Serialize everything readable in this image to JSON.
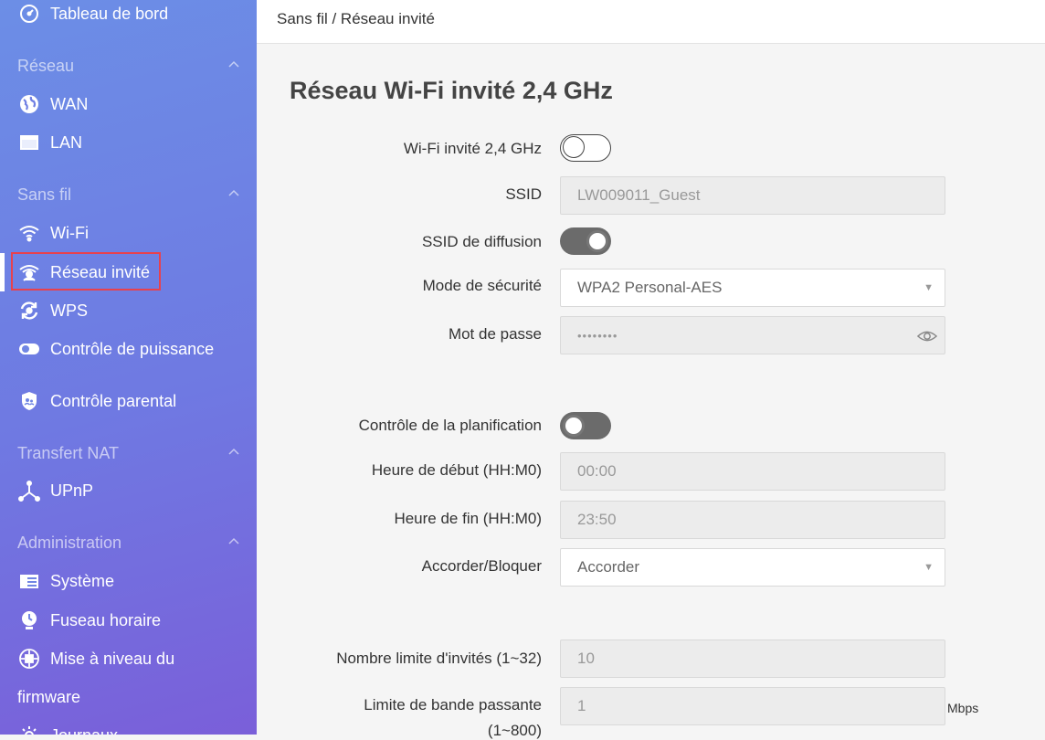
{
  "sidebar": {
    "dashboard": "Tableau de bord",
    "sections": [
      {
        "label": "Réseau",
        "items": [
          "WAN",
          "LAN"
        ]
      },
      {
        "label": "Sans fil",
        "items": [
          "Wi-Fi",
          "Réseau invité",
          "WPS",
          "Contrôle de puissance"
        ]
      },
      {
        "label": "Transfert NAT",
        "items": [
          "UPnP"
        ]
      },
      {
        "label": "Administration",
        "items": [
          "Système",
          "Fuseau horaire",
          "Mise à niveau du",
          "firmware",
          "Journaux"
        ]
      }
    ],
    "parental": "Contrôle parental",
    "active_item": "Réseau invité"
  },
  "header": {
    "breadcrumb": "Sans fil / Réseau invité"
  },
  "main": {
    "title": "Réseau Wi-Fi invité 2,4 GHz",
    "fields": {
      "wifi_guest": {
        "label": "Wi-Fi invité 2,4 GHz",
        "state": "off"
      },
      "ssid": {
        "label": "SSID",
        "value": "LW009011_Guest"
      },
      "broadcast": {
        "label": "SSID de diffusion",
        "state": "on"
      },
      "security": {
        "label": "Mode de sécurité",
        "value": "WPA2 Personal-AES"
      },
      "password": {
        "label": "Mot de passe",
        "value": "••••••••"
      },
      "schedule": {
        "label": "Contrôle de la planification",
        "state": "off"
      },
      "start": {
        "label": "Heure de début (HH:M0)",
        "value": "00:00"
      },
      "end": {
        "label": "Heure de fin (HH:M0)",
        "value": "23:50"
      },
      "allow": {
        "label": "Accorder/Bloquer",
        "value": "Accorder"
      },
      "limit": {
        "label": "Nombre limite d'invités (1~32)",
        "value": "10"
      },
      "bandwidth": {
        "label": "Limite de bande passante",
        "label2": "(1~800)",
        "value": "1",
        "unit": "Mbps"
      }
    }
  },
  "colors": {
    "accent_box": "#e8414d",
    "sidebar_top": "#6c8ee6",
    "sidebar_bottom": "#7a5fd9"
  }
}
